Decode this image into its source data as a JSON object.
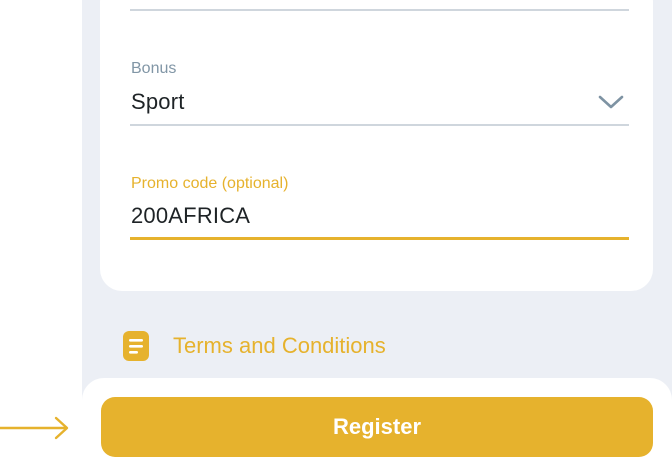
{
  "form": {
    "bonus": {
      "label": "Bonus",
      "value": "Sport",
      "icon": "chevron-down-icon"
    },
    "promo": {
      "label": "Promo code (optional)",
      "value": "200AFRICA"
    }
  },
  "terms": {
    "label": "Terms and Conditions",
    "icon": "document-icon"
  },
  "register": {
    "label": "Register"
  },
  "pointer": {
    "icon": "arrow-right-icon"
  },
  "colors": {
    "accent": "#e6b22d",
    "label_gray": "#8196a6",
    "background": "#eceff5",
    "text": "#1e2326"
  }
}
